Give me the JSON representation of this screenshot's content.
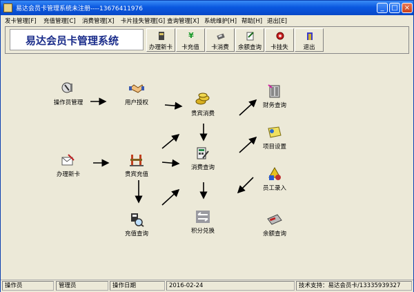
{
  "window": {
    "title": "易达会员卡管理系统未注册----13676411976",
    "controls": [
      "minimize-icon",
      "maximize-icon",
      "close-icon"
    ]
  },
  "menu": [
    "发卡管理[F]",
    "充值管理[C]",
    "消费管理[X]",
    "卡片挂失管理[G]",
    "查询管理[X]",
    "系统维护[H]",
    "帮助[H]",
    "退出[E]"
  ],
  "header": {
    "banner": "易达会员卡管理系统",
    "tools": [
      {
        "label": "办理新卡",
        "icon": "new-card-icon"
      },
      {
        "label": "卡充值",
        "icon": "yen-icon"
      },
      {
        "label": "卡消费",
        "icon": "consume-icon"
      },
      {
        "label": "余额查询",
        "icon": "balance-query-icon"
      },
      {
        "label": "卡挂失",
        "icon": "report-loss-icon"
      },
      {
        "label": "退出",
        "icon": "exit-icon"
      }
    ]
  },
  "flow": {
    "operator": "操作员管理",
    "authorize": "用户授权",
    "new_card": "办理新卡",
    "vip_recharge": "贵宾充值",
    "recharge_query": "充值查询",
    "vip_consume": "贵宾消费",
    "consume_query": "消费查询",
    "points": "积分兑换",
    "finance": "财务查询",
    "project": "项目设置",
    "staff": "员工录入",
    "balance": "余额查询"
  },
  "status": {
    "operator_label": "操作员",
    "operator_value": "管理员",
    "date_label": "操作日期",
    "date_value": "2016-02-24",
    "support": "技术支持：易达会员卡/13335939327"
  }
}
